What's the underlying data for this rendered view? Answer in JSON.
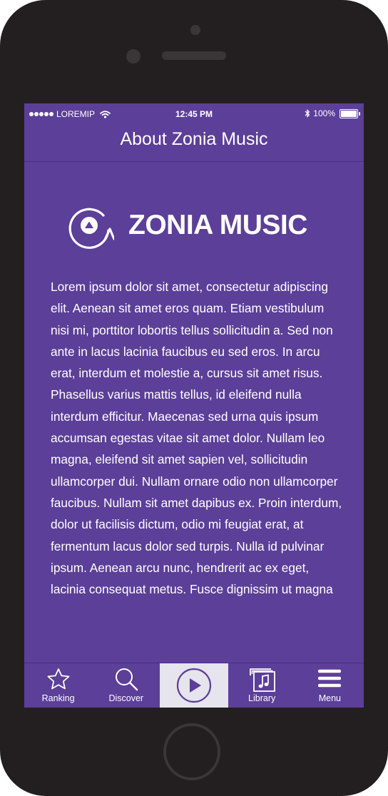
{
  "status_bar": {
    "carrier": "LOREMIP",
    "time": "12:45 PM",
    "battery": "100%"
  },
  "nav": {
    "title": "About Zonia Music"
  },
  "logo": {
    "text": "ZONIA MUSIC"
  },
  "about": {
    "body": "Lorem ipsum dolor sit amet, consectetur adipiscing elit. Aenean sit amet eros quam. Etiam vestibulum nisi mi, porttitor lobortis tellus sollicitudin a. Sed non ante in lacus lacinia faucibus eu sed eros. In arcu erat, interdum et molestie a, cursus sit amet risus. Phasellus varius mattis tellus, id eleifend nulla interdum efficitur. Maecenas sed urna quis ipsum accumsan egestas vitae sit amet dolor. Nullam leo magna, eleifend sit amet sapien vel, sollicitudin ullamcorper dui. Nullam ornare odio non ullamcorper faucibus. Nullam sit amet dapibus ex. Proin interdum, dolor ut facilisis dictum, odio mi feugiat erat, at fermentum lacus dolor sed turpis. Nulla id pulvinar ipsum. Aenean arcu nunc, hendrerit ac ex eget, lacinia consequat metus. Fusce dignissim ut magna"
  },
  "tabs": [
    {
      "label": "Ranking",
      "icon": "star-icon"
    },
    {
      "label": "Discover",
      "icon": "search-icon"
    },
    {
      "label": "",
      "icon": "play-icon",
      "active": true
    },
    {
      "label": "Library",
      "icon": "music-library-icon"
    },
    {
      "label": "Menu",
      "icon": "hamburger-menu-icon"
    }
  ],
  "colors": {
    "brand_purple": "#5c3f98",
    "device_body": "#231f20",
    "active_tab_bg": "#e6e4ec"
  }
}
